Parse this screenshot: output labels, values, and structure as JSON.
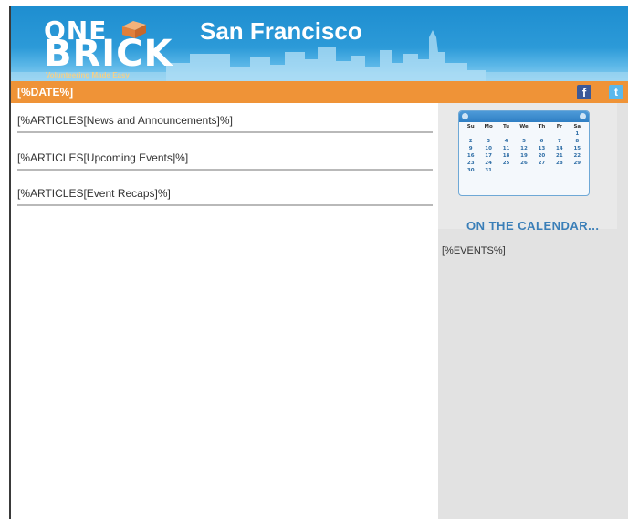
{
  "header": {
    "logo_line1": "ONE",
    "logo_line2": "BRICK",
    "tagline": "Volunteering Made Easy",
    "city": "San Francisco"
  },
  "datebar": {
    "date_placeholder": "[%DATE%]",
    "facebook_glyph": "f",
    "twitter_glyph": "t"
  },
  "main": {
    "articles": [
      {
        "label": "[%ARTICLES[News and Announcements]%]"
      },
      {
        "label": "[%ARTICLES[Upcoming Events]%]"
      },
      {
        "label": "[%ARTICLES[Event Recaps]%]"
      }
    ]
  },
  "sidebar": {
    "calendar": {
      "weekdays": [
        "Su",
        "Mo",
        "Tu",
        "We",
        "Th",
        "Fr",
        "Sa"
      ],
      "days": [
        "",
        "",
        "",
        "",
        "",
        "",
        "1",
        "2",
        "3",
        "4",
        "5",
        "6",
        "7",
        "8",
        "9",
        "10",
        "11",
        "12",
        "13",
        "14",
        "15",
        "16",
        "17",
        "18",
        "19",
        "20",
        "21",
        "22",
        "23",
        "24",
        "25",
        "26",
        "27",
        "28",
        "29",
        "30",
        "31",
        "",
        "",
        "",
        "",
        ""
      ]
    },
    "on_calendar_title": "ON THE CALENDAR...",
    "events_placeholder": "[%EVENTS%]"
  }
}
